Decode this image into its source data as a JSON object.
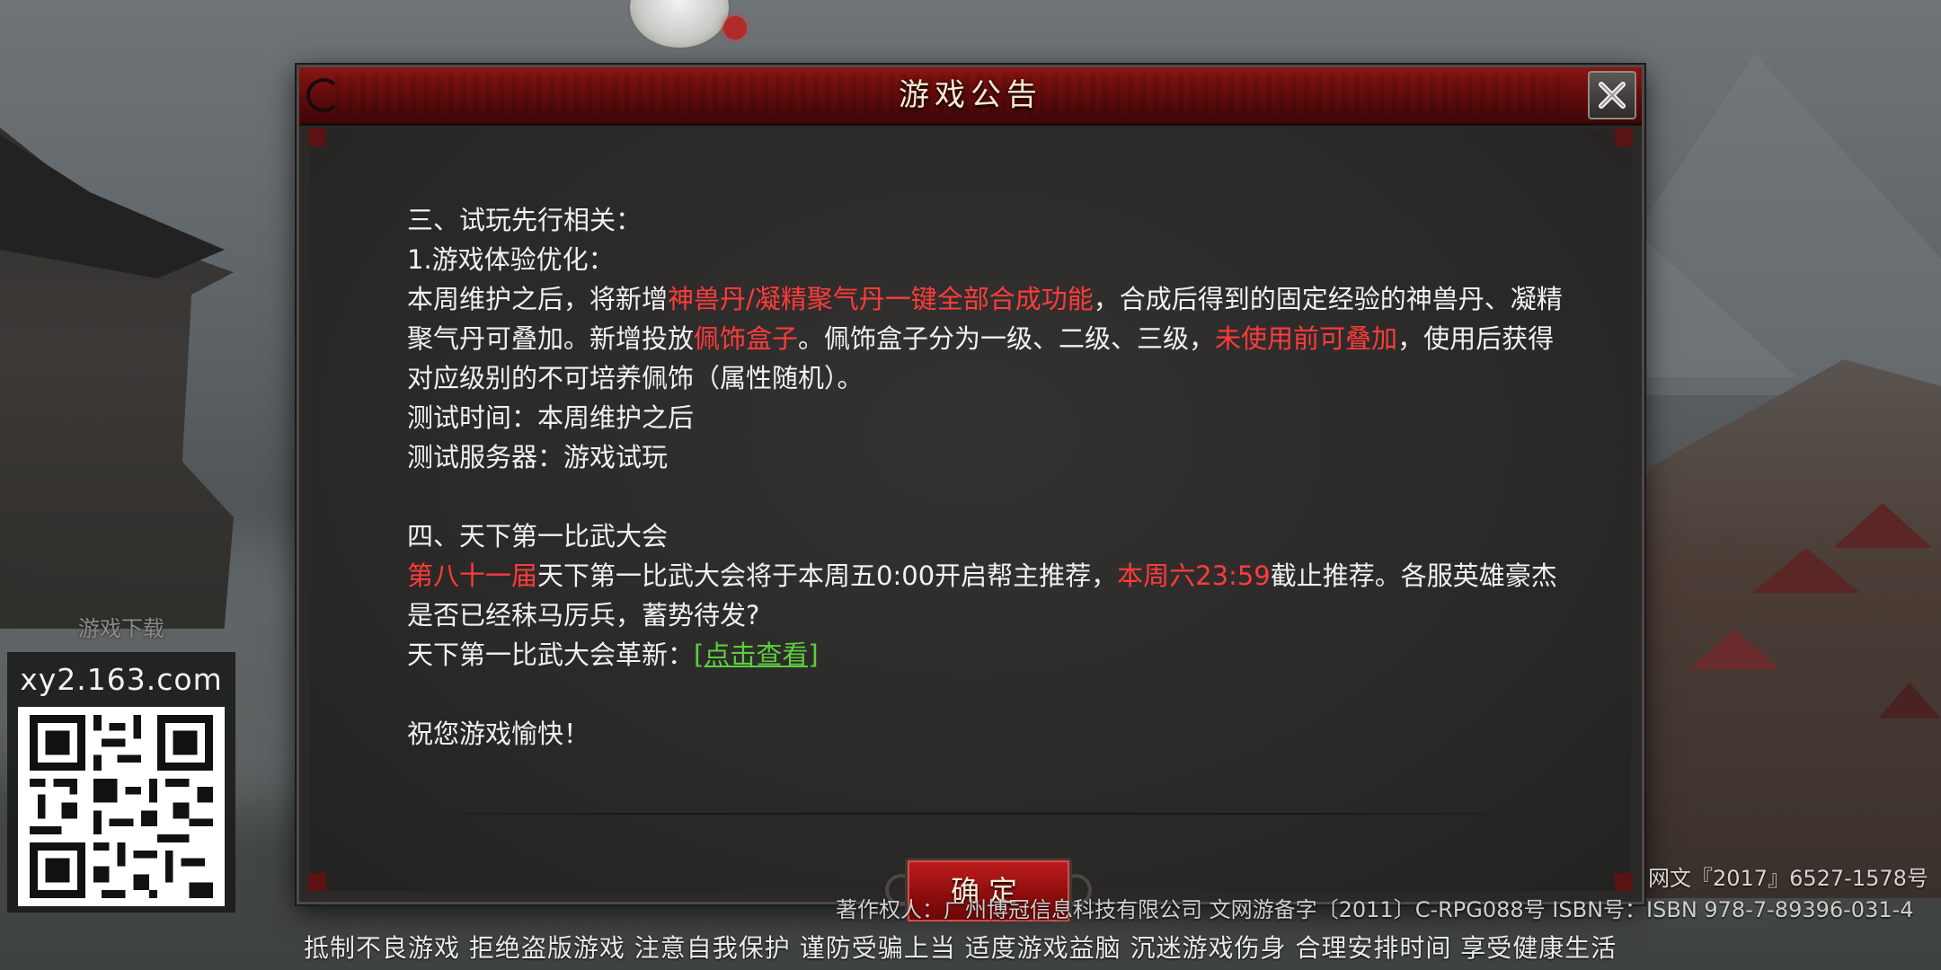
{
  "dialog": {
    "title": "游戏公告",
    "close_icon": "close-icon",
    "confirm_label": "确定"
  },
  "announcement": {
    "s3_heading": "三、试玩先行相关：",
    "s3_sub": "1.游戏体验优化：",
    "s3_p1_a": "本周维护之后，将新增",
    "s3_p1_red1": "神兽丹/凝精聚气丹一键全部合成功能",
    "s3_p1_b": "，合成后得到的固定经验的神兽丹、凝精聚气丹可叠加。新增投放",
    "s3_p1_red2": "佩饰盒子",
    "s3_p1_c": "。佩饰盒子分为一级、二级、三级，",
    "s3_p1_red3": "未使用前可叠加",
    "s3_p1_d": "，使用后获得对应级别的不可培养佩饰（属性随机）。",
    "s3_time": "测试时间：本周维护之后",
    "s3_server": "测试服务器：游戏试玩",
    "s4_heading": "四、天下第一比武大会",
    "s4_red1": "第八十一届",
    "s4_a": "天下第一比武大会将于本周五0:00开启帮主推荐，",
    "s4_red2": "本周六23:59",
    "s4_b": "截止推荐。各服英雄豪杰是否已经秣马厉兵，蓄势待发?",
    "s4_update_label": "天下第一比武大会革新：",
    "s4_update_link": "[点击查看]",
    "closing": "祝您游戏愉快！"
  },
  "side_panel": {
    "download_label": "游戏下载",
    "site": "xy2.163.com"
  },
  "footer": {
    "copyright_right": "网文『2017』6527-1578号",
    "copyright_line": "著作权人：广州博冠信息科技有限公司 文网游备字〔2011〕C-RPG088号 ISBN号：ISBN 978-7-89396-031-4",
    "health_notice": "抵制不良游戏 拒绝盗版游戏 注意自我保护 谨防受骗上当 适度游戏益脑 沉迷游戏伤身 合理安排时间 享受健康生活"
  },
  "colors": {
    "highlight_red": "#ff3b3b",
    "link_green": "#5ccf3d",
    "header_red": "#8a1515"
  }
}
